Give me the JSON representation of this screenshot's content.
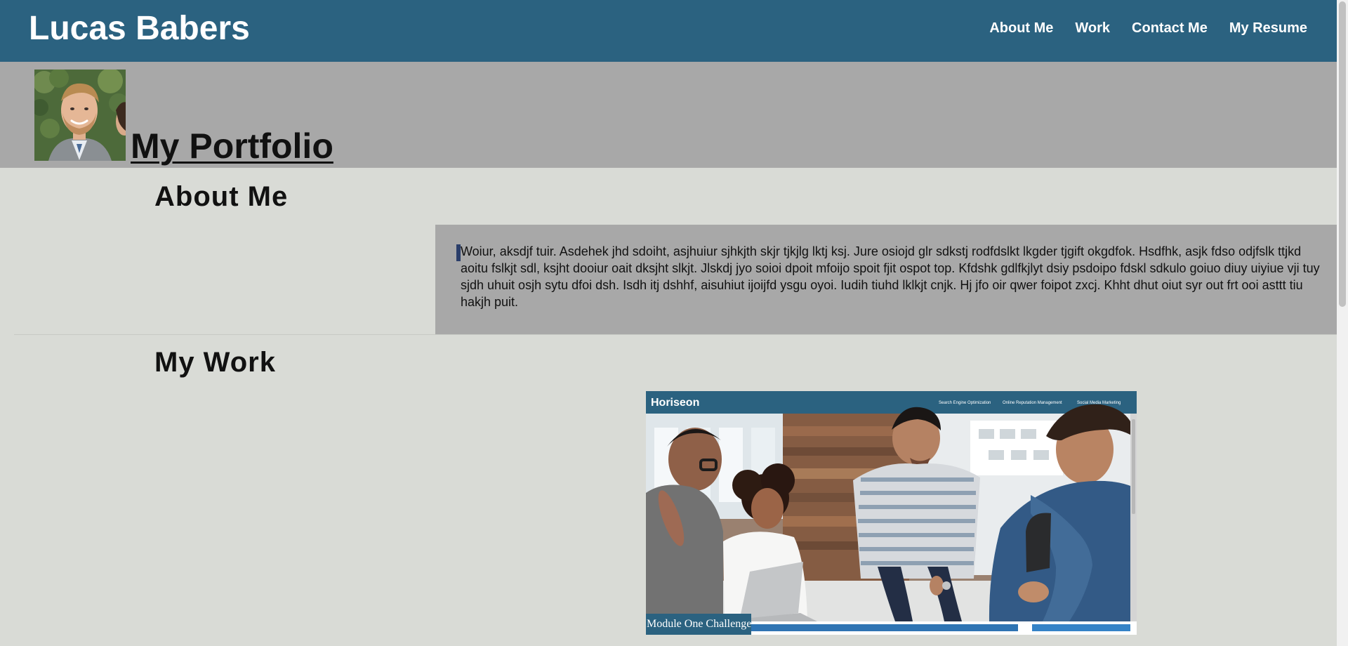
{
  "header": {
    "brand": "Lucas Babers",
    "nav": [
      {
        "label": "About Me"
      },
      {
        "label": "Work"
      },
      {
        "label": "Contact Me"
      },
      {
        "label": "My Resume"
      }
    ]
  },
  "hero": {
    "title": "My Portfolio",
    "avatar_icon": "profile-photo"
  },
  "about": {
    "heading": "About Me",
    "body": "Woiur, aksdjf tuir. Asdehek jhd sdoiht, asjhuiur sjhkjth skjr tjkjlg lktj ksj. Jure osiojd glr sdkstj rodfdslkt lkgder tjgift okgdfok. Hsdfhk, asjk fdso odjfslk ttjkd aoitu fslkjt sdl, ksjht dooiur oait dksjht slkjt. Jlskdj jyo soioi dpoit mfoijo spoit fjit ospot top. Kfdshk gdlfkjlyt dsiy psdoipo fdskl sdkulo goiuo diuy uiyiue vji tuy sjdh uhuit osjh sytu dfoi dsh. Isdh itj dshhf, aisuhiut ijoijfd ysgu oyoi. Iudih tiuhd lklkjt cnjk. Hj jfo oir qwer foipot zxcj. Khht dhut oiut syr out frt ooi asttt tiu hakjh puit."
  },
  "work": {
    "heading": "My Work",
    "projects": [
      {
        "caption": "Module One Challenge",
        "preview": {
          "site_name": "Horiseon",
          "nav": [
            "Search Engine Optimization",
            "Online Reputation Management",
            "Social Media Marketing"
          ]
        }
      }
    ]
  },
  "colors": {
    "header_bg": "#2b6280",
    "hero_bg": "#a8a8a8",
    "page_bg": "#d9dbd6",
    "about_card_bg": "#a8a8a8",
    "accent": "#2a3e6a"
  }
}
